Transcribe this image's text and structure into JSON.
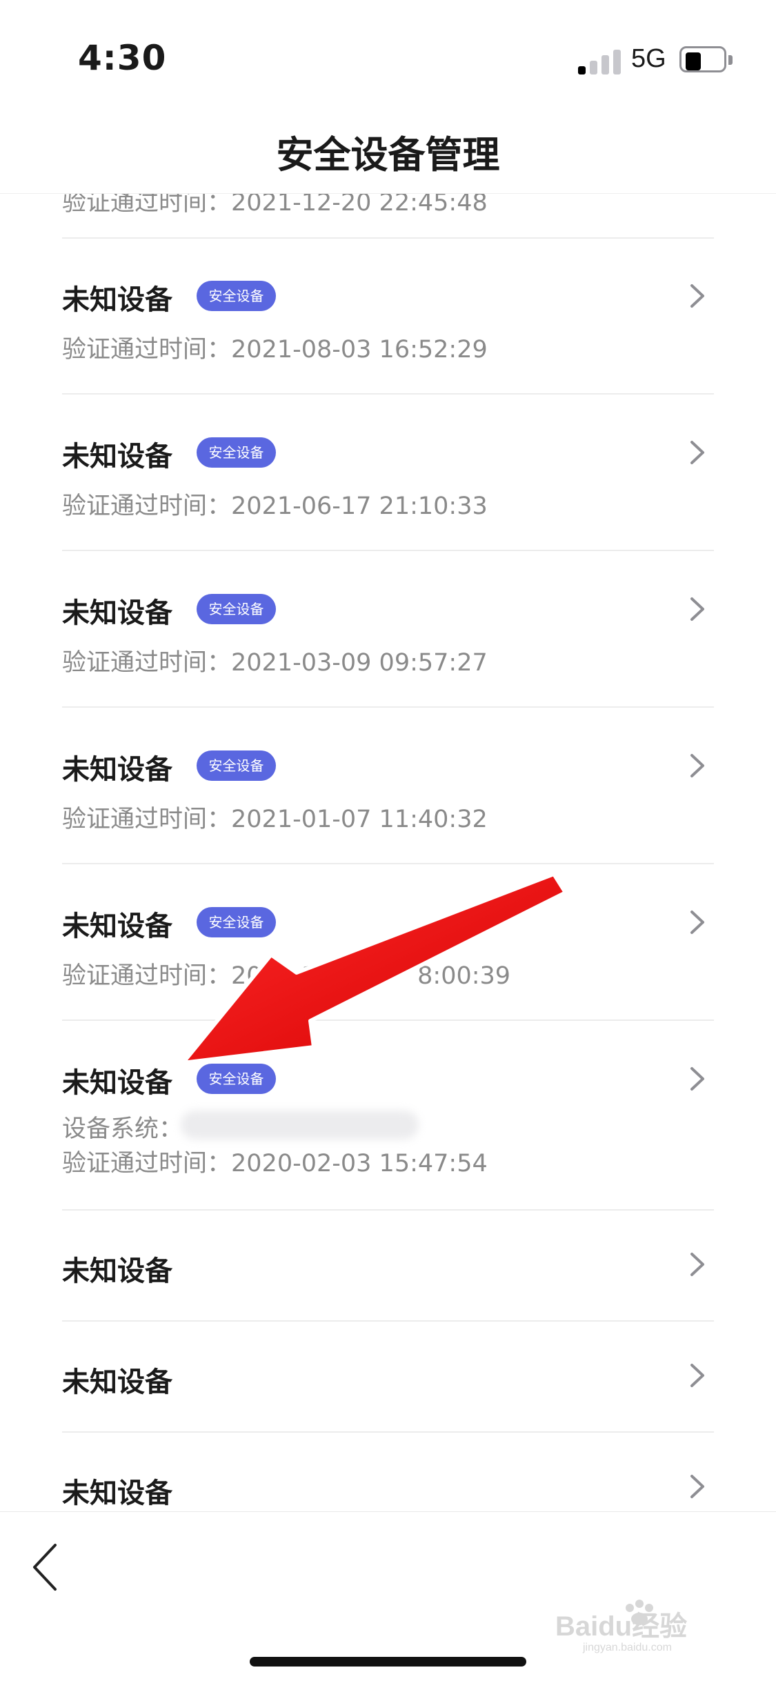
{
  "status_bar": {
    "time": "4:30",
    "network": "5G"
  },
  "header": {
    "title": "安全设备管理"
  },
  "devices": [
    {
      "name": "未知设备",
      "badge": "安全设备",
      "time_label": "验证通过时间：",
      "time_value": "2021-08-03 16:52:29"
    },
    {
      "name": "未知设备",
      "badge": "安全设备",
      "time_label": "验证通过时间：",
      "time_value": "2021-06-17 21:10:33"
    },
    {
      "name": "未知设备",
      "badge": "安全设备",
      "time_label": "验证通过时间：",
      "time_value": "2021-03-09 09:57:27"
    },
    {
      "name": "未知设备",
      "badge": "安全设备",
      "time_label": "验证通过时间：",
      "time_value": "2021-01-07 11:40:32"
    },
    {
      "name": "未知设备",
      "badge": "安全设备",
      "time_label": "验证通过时间：",
      "time_value": "2020-10-1        8:00:39"
    },
    {
      "name": "未知设备",
      "badge": "安全设备",
      "system_label": "设备系统：",
      "time_label": "验证通过时间：",
      "time_value": "2020-02-03 15:47:54"
    },
    {
      "name": "未知设备"
    },
    {
      "name": "未知设备"
    },
    {
      "name": "未知设备"
    }
  ],
  "watermark": {
    "text": "Baidu经验",
    "subtext": "jingyan.baidu.com"
  },
  "colors": {
    "badge": "#5a67e0",
    "arrow": "#e8141b",
    "meta_text": "#8a8a8a"
  },
  "icons": {
    "chevron": "chevron-right-icon",
    "back": "chevron-left-icon",
    "signal": "cellular-signal-icon",
    "battery": "battery-icon"
  }
}
